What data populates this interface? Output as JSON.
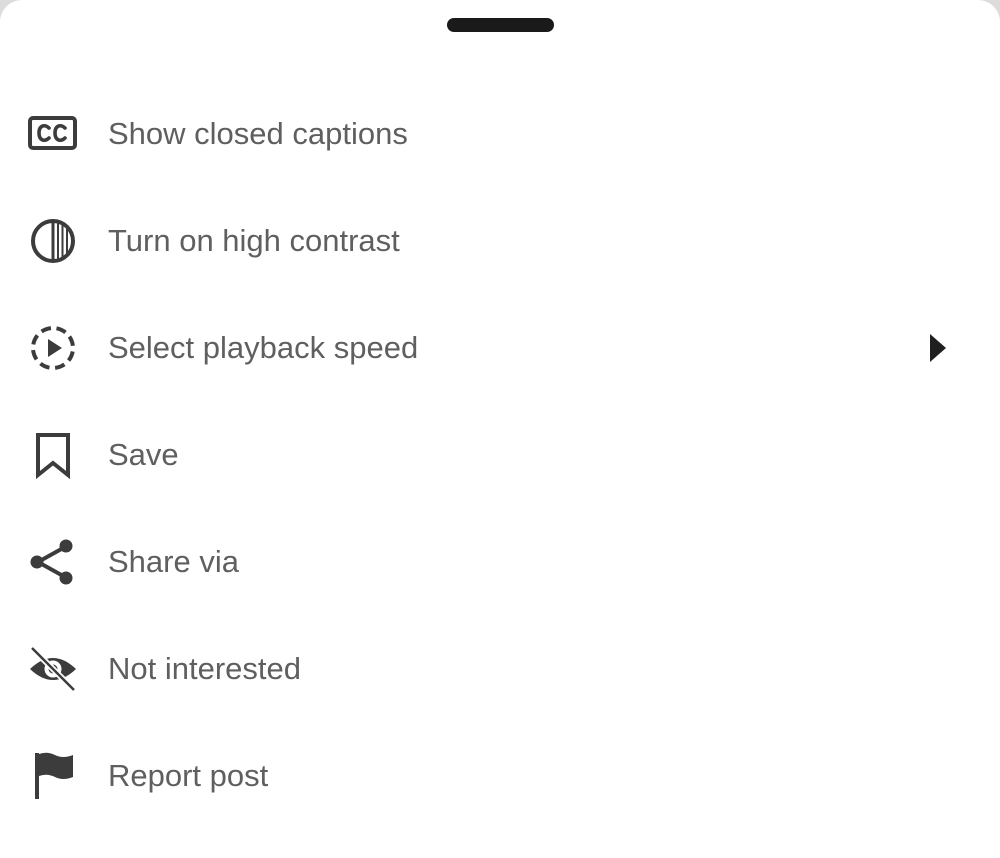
{
  "menu": {
    "items": [
      {
        "label": "Show closed captions",
        "icon": "closed-captions-icon"
      },
      {
        "label": "Turn on high contrast",
        "icon": "high-contrast-icon"
      },
      {
        "label": "Select playback speed",
        "icon": "playback-speed-icon",
        "has_submenu": true
      },
      {
        "label": "Save",
        "icon": "bookmark-icon"
      },
      {
        "label": "Share via",
        "icon": "share-icon"
      },
      {
        "label": "Not interested",
        "icon": "eye-off-icon"
      },
      {
        "label": "Report post",
        "icon": "flag-icon"
      }
    ]
  },
  "colors": {
    "sheet_background": "#ffffff",
    "text": "#5f5f5f",
    "icon": "#3c3c3c",
    "handle": "#1a1a1a"
  }
}
